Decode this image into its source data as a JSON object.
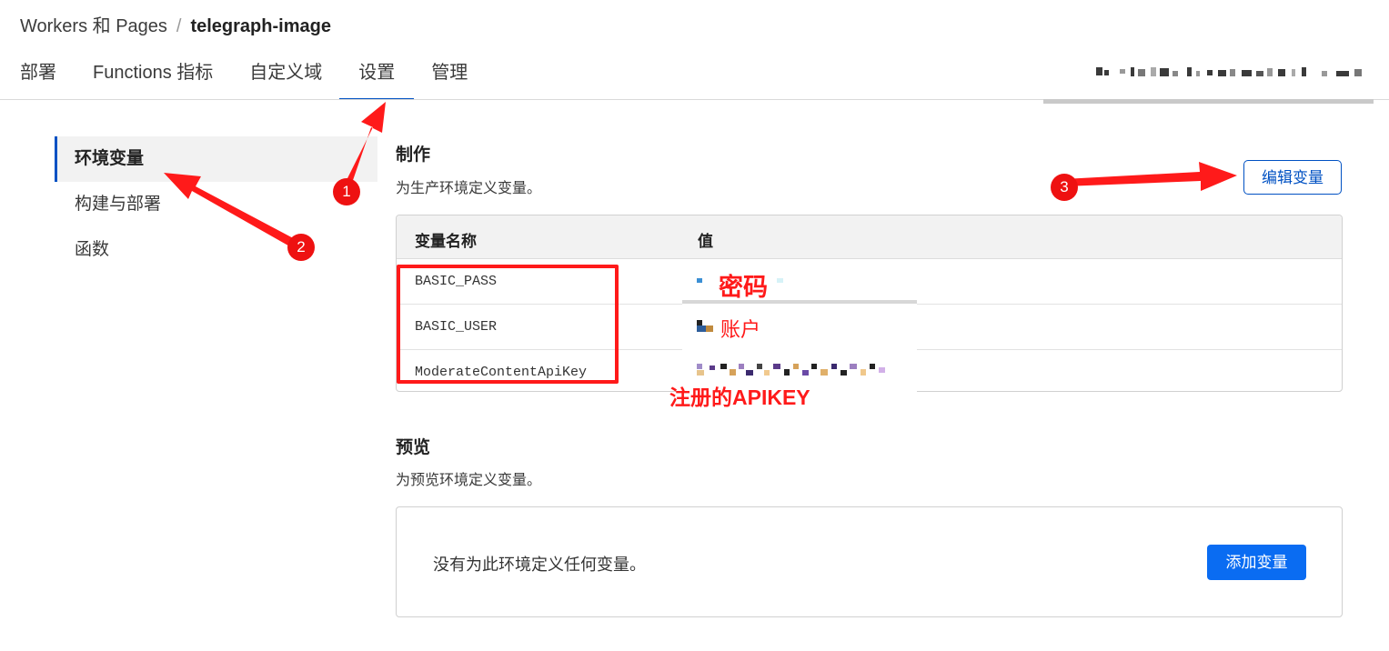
{
  "breadcrumb": {
    "parent": "Workers 和 Pages",
    "separator": "/",
    "current": "telegraph-image"
  },
  "tabs": [
    {
      "label": "部署",
      "active": false
    },
    {
      "label": "Functions 指标",
      "active": false
    },
    {
      "label": "自定义域",
      "active": false
    },
    {
      "label": "设置",
      "active": true
    },
    {
      "label": "管理",
      "active": false
    }
  ],
  "sidebar": {
    "items": [
      {
        "label": "环境变量",
        "active": true
      },
      {
        "label": "构建与部署",
        "active": false
      },
      {
        "label": "函数",
        "active": false
      }
    ]
  },
  "production": {
    "title": "制作",
    "description": "为生产环境定义变量。",
    "edit_button": "编辑变量",
    "table": {
      "headers": [
        "变量名称",
        "值"
      ],
      "rows": [
        {
          "name": "BASIC_PASS"
        },
        {
          "name": "BASIC_USER"
        },
        {
          "name": "ModerateContentApiKey"
        }
      ]
    }
  },
  "preview": {
    "title": "预览",
    "description": "为预览环境定义变量。",
    "empty_text": "没有为此环境定义任何变量。",
    "add_button": "添加变量"
  },
  "annotations": {
    "password_label": "密码",
    "account_label": "账户",
    "apikey_label": "注册的APIKEY",
    "steps": [
      "1",
      "2",
      "3"
    ]
  },
  "colors": {
    "accent": "#0051c3",
    "primary_button": "#0a6cf2",
    "annotation_red": "#ff1a1a"
  }
}
